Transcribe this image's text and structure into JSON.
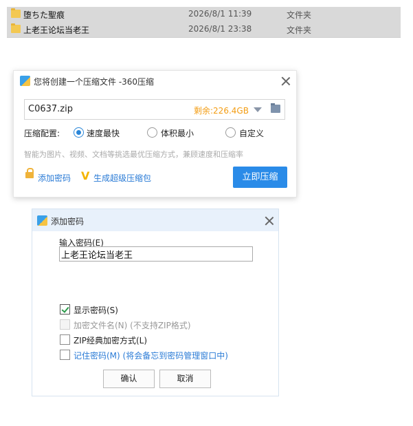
{
  "file_list": {
    "rows": [
      {
        "name": "堕ちた聖痕",
        "date": "2026/8/1 11:39",
        "type": "文件夹"
      },
      {
        "name": "上老王论坛当老王",
        "date": "2026/8/1 23:38",
        "type": "文件夹"
      }
    ]
  },
  "compress_dialog": {
    "title": "您将创建一个压缩文件 -360压缩",
    "filename": "C0637.zip",
    "remaining": "剩余:226.4GB",
    "config_label": "压缩配置:",
    "options": [
      "速度最快",
      "体积最小",
      "自定义"
    ],
    "selected_option": "速度最快",
    "hint": "智能为图片、视频、文档等挑选最优压缩方式，兼顾速度和压缩率",
    "add_password_link": "添加密码",
    "super_zip_link": "生成超级压缩包",
    "compress_button": "立即压缩"
  },
  "password_dialog": {
    "title": "添加密码",
    "input_label": "输入密码(E)",
    "password_value": "上老王论坛当老王",
    "checkboxes": [
      {
        "label": "显示密码(S)",
        "checked": true,
        "enabled": true
      },
      {
        "label": "加密文件名(N) (不支持ZIP格式)",
        "checked": false,
        "enabled": false
      },
      {
        "label": "ZIP经典加密方式(L)",
        "checked": false,
        "enabled": true
      },
      {
        "label": "记住密码(M) (将会备忘到密码管理窗口中)",
        "checked": false,
        "enabled": true
      }
    ],
    "ok_button": "确认",
    "cancel_button": "取消"
  },
  "colors": {
    "accent_blue": "#2a8be8",
    "remaining_orange": "#f39c12",
    "link_blue": "#2a7bd6",
    "check_green": "#2a9a4a"
  }
}
